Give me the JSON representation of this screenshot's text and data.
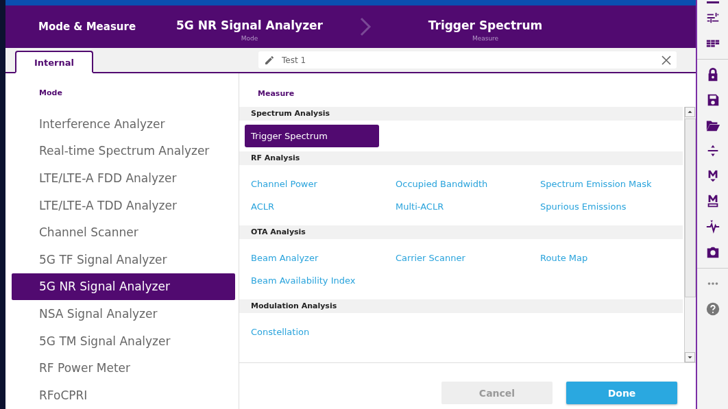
{
  "header": {
    "title": "Mode & Measure",
    "mode": {
      "value": "5G NR Signal Analyzer",
      "label": "Mode"
    },
    "measure": {
      "value": "Trigger Spectrum",
      "label": "Measure"
    }
  },
  "tabs": [
    {
      "label": "Internal",
      "selected": true
    }
  ],
  "name_field": {
    "value": "Test 1"
  },
  "mode_panel": {
    "heading": "Mode",
    "items": [
      {
        "label": "Interference Analyzer",
        "selected": false
      },
      {
        "label": "Real-time Spectrum Analyzer",
        "selected": false
      },
      {
        "label": "LTE/LTE-A FDD Analyzer",
        "selected": false
      },
      {
        "label": "LTE/LTE-A TDD Analyzer",
        "selected": false
      },
      {
        "label": "Channel Scanner",
        "selected": false
      },
      {
        "label": "5G TF Signal Analyzer",
        "selected": false
      },
      {
        "label": "5G NR Signal Analyzer",
        "selected": true
      },
      {
        "label": "NSA Signal Analyzer",
        "selected": false
      },
      {
        "label": "5G TM Signal Analyzer",
        "selected": false
      },
      {
        "label": "RF Power Meter",
        "selected": false
      },
      {
        "label": "RFoCPRI",
        "selected": false
      }
    ]
  },
  "measure_panel": {
    "heading": "Measure",
    "sections": [
      {
        "title": "Spectrum Analysis",
        "items": [
          {
            "label": "Trigger Spectrum",
            "selected": true
          }
        ]
      },
      {
        "title": "RF Analysis",
        "items": [
          {
            "label": "Channel Power",
            "selected": false
          },
          {
            "label": "Occupied Bandwidth",
            "selected": false
          },
          {
            "label": "Spectrum Emission Mask",
            "selected": false
          },
          {
            "label": "ACLR",
            "selected": false
          },
          {
            "label": "Multi-ACLR",
            "selected": false
          },
          {
            "label": "Spurious Emissions",
            "selected": false
          }
        ]
      },
      {
        "title": "OTA Analysis",
        "items": [
          {
            "label": "Beam Analyzer",
            "selected": false
          },
          {
            "label": "Carrier Scanner",
            "selected": false
          },
          {
            "label": "Route Map",
            "selected": false
          },
          {
            "label": "Beam Availability Index",
            "selected": false
          }
        ]
      },
      {
        "title": "Modulation Analysis",
        "items": [
          {
            "label": "Constellation",
            "selected": false
          }
        ]
      }
    ]
  },
  "buttons": [
    {
      "label": "Cancel",
      "kind": "secondary",
      "disabled": true
    },
    {
      "label": "Done",
      "kind": "primary",
      "disabled": false
    }
  ]
}
